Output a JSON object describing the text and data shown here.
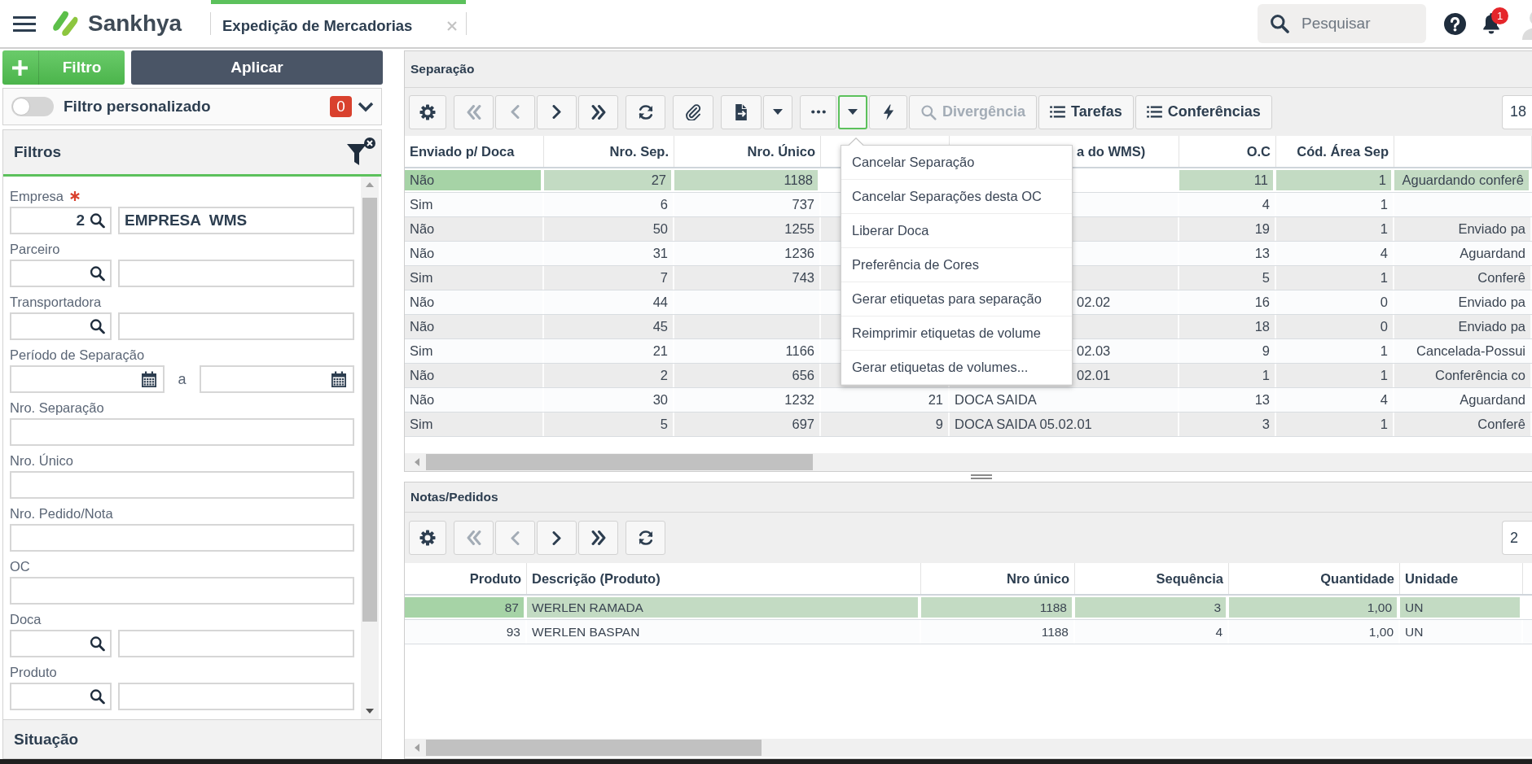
{
  "header": {
    "app_name": "Sankhya",
    "tab": {
      "title": "Expedição de Mercadorias",
      "selected": true
    },
    "search": {
      "placeholder": "Pesquisar"
    },
    "notification_badge": "1"
  },
  "filter_panel": {
    "add_filter_button": "Filtro",
    "apply_button": "Aplicar",
    "custom_filter": {
      "label": "Filtro personalizado",
      "on": false,
      "count": "0"
    },
    "section_title": "Filtros",
    "fields": [
      {
        "kind": "lookup",
        "label": "Empresa",
        "required": true,
        "code": "2",
        "description": "EMPRESA  WMS"
      },
      {
        "kind": "lookup",
        "label": "Parceiro",
        "required": false
      },
      {
        "kind": "lookup",
        "label": "Transportadora",
        "required": false
      },
      {
        "kind": "range",
        "label": "Período de Separação",
        "required": false,
        "separator": "a"
      },
      {
        "kind": "text",
        "label": "Nro. Separação",
        "required": false
      },
      {
        "kind": "text",
        "label": "Nro. Único",
        "required": false
      },
      {
        "kind": "text",
        "label": "Nro. Pedido/Nota",
        "required": false
      },
      {
        "kind": "text",
        "label": "OC",
        "required": false
      },
      {
        "kind": "lookup",
        "label": "Doca",
        "required": false
      },
      {
        "kind": "lookup",
        "label": "Produto",
        "required": false
      }
    ],
    "next_section": "Situação"
  },
  "separacao": {
    "title": "Separação",
    "toolbar": [
      [
        {
          "kind": "gear",
          "disabled": false
        }
      ],
      [
        {
          "kind": "first",
          "disabled": true
        },
        {
          "kind": "prev",
          "disabled": true
        },
        {
          "kind": "next",
          "disabled": false
        },
        {
          "kind": "last",
          "disabled": false
        }
      ],
      [
        {
          "kind": "refresh",
          "disabled": false
        }
      ],
      [
        {
          "kind": "clip",
          "disabled": false
        }
      ],
      [
        {
          "kind": "export",
          "disabled": false
        },
        {
          "kind": "caret",
          "disabled": false,
          "expanded": false
        }
      ],
      [
        {
          "kind": "more",
          "disabled": false
        },
        {
          "kind": "caret",
          "disabled": false,
          "expanded": true
        },
        {
          "kind": "bolt",
          "disabled": false
        },
        {
          "kind": "find",
          "label": "Divergência",
          "disabled": true
        },
        {
          "kind": "list",
          "label": "Tarefas",
          "disabled": false
        },
        {
          "kind": "list",
          "label": "Conferências",
          "disabled": false
        }
      ]
    ],
    "number_field": "18",
    "menu": {
      "items": [
        "Cancelar Separação",
        "Cancelar Separações desta OC",
        "Liberar Doca",
        "Preferência de Cores",
        "Gerar etiquetas para separação",
        "Reimprimir etiquetas de volume",
        "Gerar etiquetas de volumes..."
      ]
    },
    "grid": {
      "columns": [
        {
          "label": "Enviado p/ Doca",
          "kind": "text"
        },
        {
          "label": "Nro. Sep.",
          "kind": "number"
        },
        {
          "label": "Nro. Único",
          "kind": "number"
        },
        {
          "kind": "number"
        },
        {
          "label": "a do WMS)",
          "kind": "text"
        },
        {
          "label": "O.C",
          "kind": "number"
        },
        {
          "label": "Cód. Área Sep",
          "kind": "number"
        },
        {
          "kind": "status"
        }
      ],
      "rows": [
        {
          "selected": true,
          "cells": [
            "Não",
            "27",
            "1188",
            null,
            null,
            "11",
            "1",
            "Aguardando conferê"
          ]
        },
        {
          "selected": false,
          "cells": [
            "Sim",
            "6",
            "737",
            null,
            null,
            "4",
            "1",
            null
          ]
        },
        {
          "selected": false,
          "cells": [
            "Não",
            "50",
            "1255",
            null,
            null,
            "19",
            "1",
            "Enviado pa"
          ]
        },
        {
          "selected": false,
          "cells": [
            "Não",
            "31",
            "1236",
            null,
            null,
            "13",
            "4",
            "Aguardand"
          ]
        },
        {
          "selected": false,
          "cells": [
            "Sim",
            "7",
            "743",
            null,
            null,
            "5",
            "1",
            "Conferê"
          ]
        },
        {
          "selected": false,
          "cells": [
            "Não",
            "44",
            null,
            null,
            "02.02",
            "16",
            "0",
            "Enviado pa"
          ]
        },
        {
          "selected": false,
          "cells": [
            "Não",
            "45",
            null,
            null,
            null,
            "18",
            "0",
            "Enviado pa"
          ]
        },
        {
          "selected": false,
          "cells": [
            "Sim",
            "21",
            "1166",
            null,
            "02.03",
            "9",
            "1",
            "Cancelada-Possui"
          ]
        },
        {
          "selected": false,
          "cells": [
            "Não",
            "2",
            "656",
            null,
            "02.01",
            "1",
            "1",
            "Conferência co"
          ]
        },
        {
          "selected": false,
          "cells": [
            "Não",
            "30",
            "1232",
            "21",
            "DOCA SAIDA",
            "13",
            "4",
            "Aguardand"
          ]
        },
        {
          "selected": false,
          "cells": [
            "Sim",
            "5",
            "697",
            "9",
            "DOCA SAIDA 05.02.01",
            "3",
            "1",
            "Conferê"
          ]
        }
      ]
    }
  },
  "notas_pedidos": {
    "title": "Notas/Pedidos",
    "toolbar": [
      [
        {
          "kind": "gear",
          "disabled": false
        }
      ],
      [
        {
          "kind": "first",
          "disabled": true
        },
        {
          "kind": "prev",
          "disabled": true
        },
        {
          "kind": "next",
          "disabled": false
        },
        {
          "kind": "last",
          "disabled": false
        }
      ],
      [
        {
          "kind": "refresh",
          "disabled": false
        }
      ]
    ],
    "number_field": "2",
    "grid": {
      "columns": [
        {
          "label": "Produto",
          "kind": "number"
        },
        {
          "label": "Descrição (Produto)",
          "kind": "text"
        },
        {
          "label": "Nro único",
          "kind": "number"
        },
        {
          "label": "Sequência",
          "kind": "number"
        },
        {
          "label": "Quantidade",
          "kind": "number"
        },
        {
          "label": "Unidade",
          "kind": "text"
        }
      ],
      "rows": [
        {
          "selected": true,
          "cells": [
            "87",
            "WERLEN RAMADA",
            "1188",
            "3",
            "1,00",
            "UN"
          ]
        },
        {
          "selected": false,
          "cells": [
            "93",
            "WERLEN BASPAN",
            "1188",
            "4",
            "1,00",
            "UN"
          ]
        }
      ]
    }
  }
}
